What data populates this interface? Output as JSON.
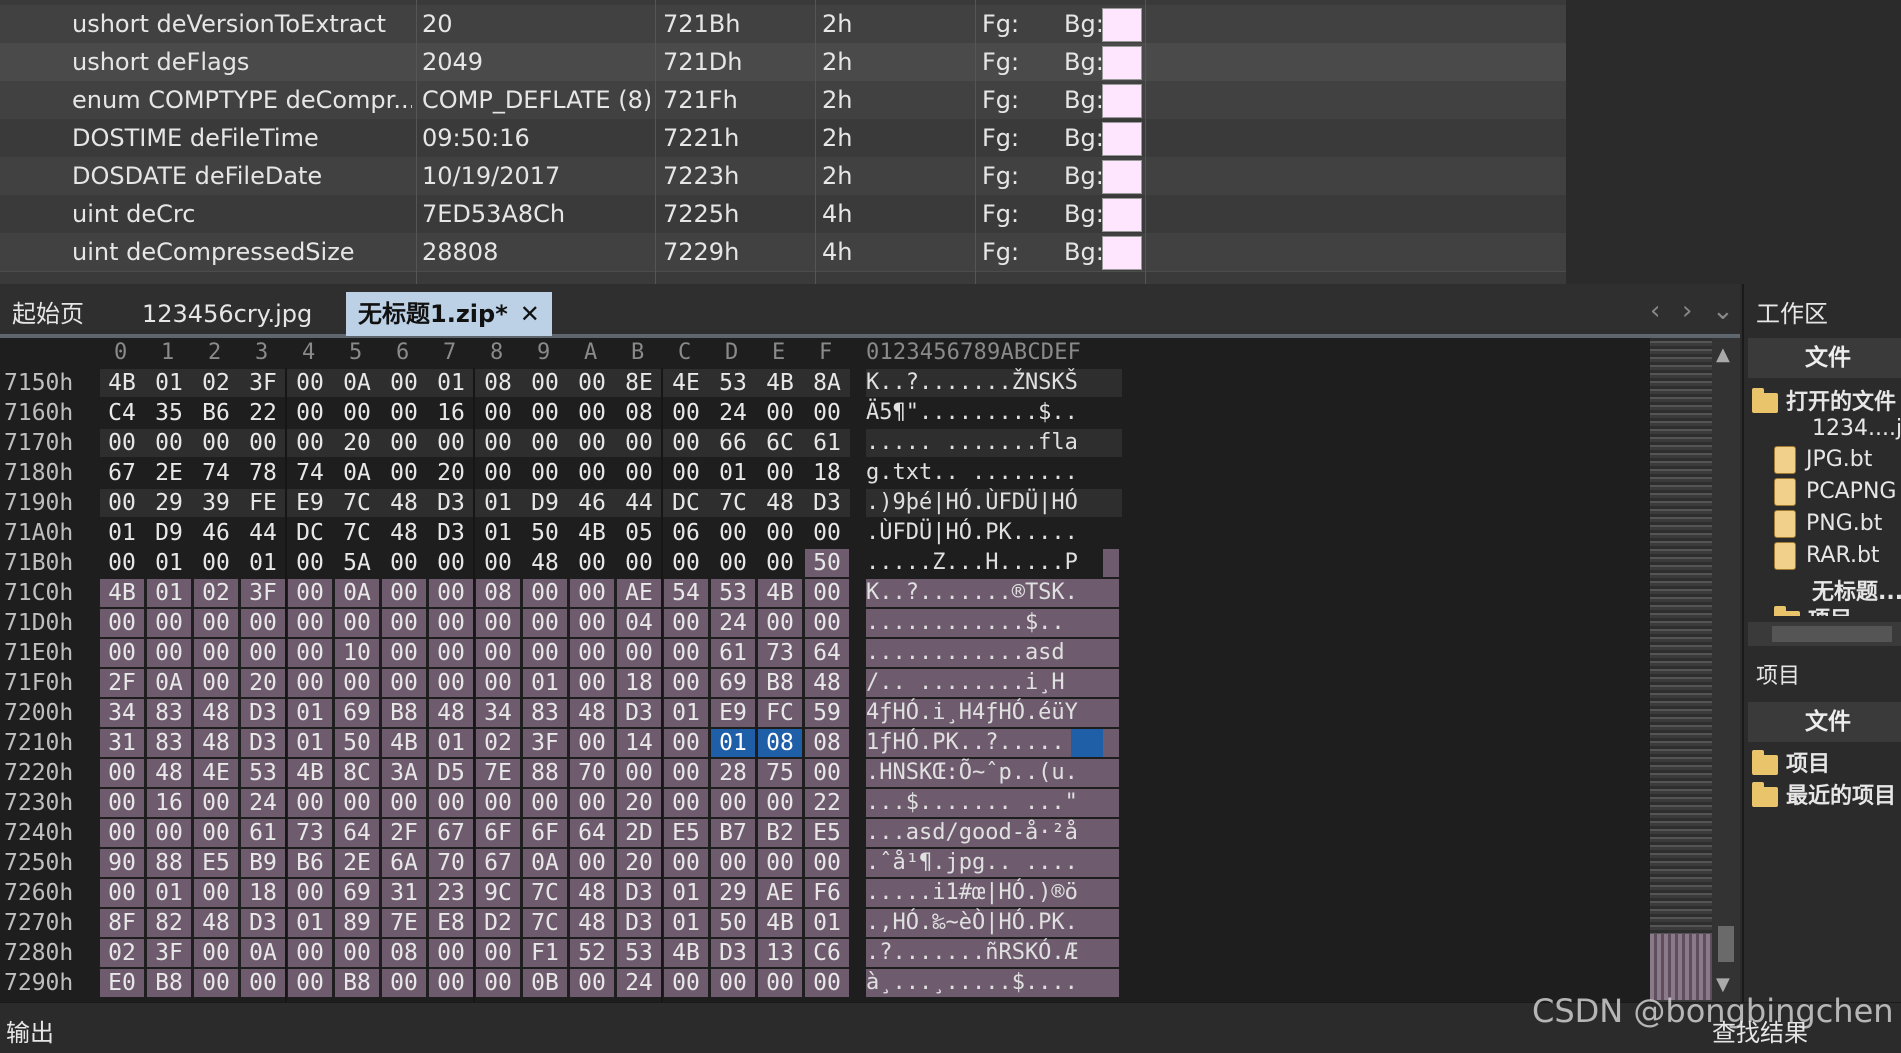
{
  "template": {
    "fg_label": "Fg:",
    "bg_label": "Bg:",
    "bg_color": "#ffe6ff",
    "rows": [
      {
        "name": "ushort deVersionToExtract",
        "value": "20",
        "start": "721Bh",
        "size": "2h"
      },
      {
        "name": "ushort deFlags",
        "value": "2049",
        "start": "721Dh",
        "size": "2h"
      },
      {
        "name": "enum COMPTYPE deCompr...",
        "value": "COMP_DEFLATE (8)",
        "start": "721Fh",
        "size": "2h"
      },
      {
        "name": "DOSTIME deFileTime",
        "value": "09:50:16",
        "start": "7221h",
        "size": "2h"
      },
      {
        "name": "DOSDATE deFileDate",
        "value": "10/19/2017",
        "start": "7223h",
        "size": "2h"
      },
      {
        "name": "uint deCrc",
        "value": "7ED53A8Ch",
        "start": "7225h",
        "size": "4h"
      },
      {
        "name": "uint deCompressedSize",
        "value": "28808",
        "start": "7229h",
        "size": "4h"
      }
    ]
  },
  "tabs": [
    {
      "label": "起始页"
    },
    {
      "label": "123456cry.jpg"
    },
    {
      "label": "无标题1.zip*"
    }
  ],
  "tab_close_symbol": "✕",
  "hex": {
    "columns": [
      "0",
      "1",
      "2",
      "3",
      "4",
      "5",
      "6",
      "7",
      "8",
      "9",
      "A",
      "B",
      "C",
      "D",
      "E",
      "F"
    ],
    "ascii_header": "0123456789ABCDEF",
    "rows": [
      {
        "addr": "7150h",
        "bytes": [
          "4B",
          "01",
          "02",
          "3F",
          "00",
          "0A",
          "00",
          "01",
          "08",
          "00",
          "00",
          "8E",
          "4E",
          "53",
          "4B",
          "8A"
        ],
        "ascii": "K..?.......ŽNSKŠ"
      },
      {
        "addr": "7160h",
        "bytes": [
          "C4",
          "35",
          "B6",
          "22",
          "00",
          "00",
          "00",
          "16",
          "00",
          "00",
          "00",
          "08",
          "00",
          "24",
          "00",
          "00"
        ],
        "ascii": "Ä5¶\".........$.."
      },
      {
        "addr": "7170h",
        "bytes": [
          "00",
          "00",
          "00",
          "00",
          "00",
          "20",
          "00",
          "00",
          "00",
          "00",
          "00",
          "00",
          "00",
          "66",
          "6C",
          "61"
        ],
        "ascii": "..... .......fla"
      },
      {
        "addr": "7180h",
        "bytes": [
          "67",
          "2E",
          "74",
          "78",
          "74",
          "0A",
          "00",
          "20",
          "00",
          "00",
          "00",
          "00",
          "00",
          "01",
          "00",
          "18"
        ],
        "ascii": "g.txt.. ........"
      },
      {
        "addr": "7190h",
        "bytes": [
          "00",
          "29",
          "39",
          "FE",
          "E9",
          "7C",
          "48",
          "D3",
          "01",
          "D9",
          "46",
          "44",
          "DC",
          "7C",
          "48",
          "D3"
        ],
        "ascii": ".)9þé|HÓ.ÙFDÜ|HÓ"
      },
      {
        "addr": "71A0h",
        "bytes": [
          "01",
          "D9",
          "46",
          "44",
          "DC",
          "7C",
          "48",
          "D3",
          "01",
          "50",
          "4B",
          "05",
          "06",
          "00",
          "00",
          "00"
        ],
        "ascii": ".ÙFDÜ|HÓ.PK....."
      },
      {
        "addr": "71B0h",
        "bytes": [
          "00",
          "01",
          "00",
          "01",
          "00",
          "5A",
          "00",
          "00",
          "00",
          "48",
          "00",
          "00",
          "00",
          "00",
          "00",
          "50"
        ],
        "ascii": ".....Z...H.....P"
      },
      {
        "addr": "71C0h",
        "bytes": [
          "4B",
          "01",
          "02",
          "3F",
          "00",
          "0A",
          "00",
          "00",
          "08",
          "00",
          "00",
          "AE",
          "54",
          "53",
          "4B",
          "00"
        ],
        "ascii": "K..?.......®TSK."
      },
      {
        "addr": "71D0h",
        "bytes": [
          "00",
          "00",
          "00",
          "00",
          "00",
          "00",
          "00",
          "00",
          "00",
          "00",
          "00",
          "04",
          "00",
          "24",
          "00",
          "00"
        ],
        "ascii": "............$.."
      },
      {
        "addr": "71E0h",
        "bytes": [
          "00",
          "00",
          "00",
          "00",
          "00",
          "10",
          "00",
          "00",
          "00",
          "00",
          "00",
          "00",
          "00",
          "61",
          "73",
          "64"
        ],
        "ascii": "............asd"
      },
      {
        "addr": "71F0h",
        "bytes": [
          "2F",
          "0A",
          "00",
          "20",
          "00",
          "00",
          "00",
          "00",
          "00",
          "01",
          "00",
          "18",
          "00",
          "69",
          "B8",
          "48"
        ],
        "ascii": "/.. ........i¸H"
      },
      {
        "addr": "7200h",
        "bytes": [
          "34",
          "83",
          "48",
          "D3",
          "01",
          "69",
          "B8",
          "48",
          "34",
          "83",
          "48",
          "D3",
          "01",
          "E9",
          "FC",
          "59"
        ],
        "ascii": "4ƒHÓ.i¸H4ƒHÓ.éüY"
      },
      {
        "addr": "7210h",
        "bytes": [
          "31",
          "83",
          "48",
          "D3",
          "01",
          "50",
          "4B",
          "01",
          "02",
          "3F",
          "00",
          "14",
          "00",
          "01",
          "08",
          "08"
        ],
        "ascii": "1ƒHÓ.PK..?....."
      },
      {
        "addr": "7220h",
        "bytes": [
          "00",
          "48",
          "4E",
          "53",
          "4B",
          "8C",
          "3A",
          "D5",
          "7E",
          "88",
          "70",
          "00",
          "00",
          "28",
          "75",
          "00"
        ],
        "ascii": ".HNSKŒ:Õ~ˆp..(u."
      },
      {
        "addr": "7230h",
        "bytes": [
          "00",
          "16",
          "00",
          "24",
          "00",
          "00",
          "00",
          "00",
          "00",
          "00",
          "00",
          "20",
          "00",
          "00",
          "00",
          "22"
        ],
        "ascii": "...$....... ...\""
      },
      {
        "addr": "7240h",
        "bytes": [
          "00",
          "00",
          "00",
          "61",
          "73",
          "64",
          "2F",
          "67",
          "6F",
          "6F",
          "64",
          "2D",
          "E5",
          "B7",
          "B2",
          "E5"
        ],
        "ascii": "...asd/good-å·²å"
      },
      {
        "addr": "7250h",
        "bytes": [
          "90",
          "88",
          "E5",
          "B9",
          "B6",
          "2E",
          "6A",
          "70",
          "67",
          "0A",
          "00",
          "20",
          "00",
          "00",
          "00",
          "00"
        ],
        "ascii": ".ˆå¹¶.jpg.. ...."
      },
      {
        "addr": "7260h",
        "bytes": [
          "00",
          "01",
          "00",
          "18",
          "00",
          "69",
          "31",
          "23",
          "9C",
          "7C",
          "48",
          "D3",
          "01",
          "29",
          "AE",
          "F6"
        ],
        "ascii": ".....i1#œ|HÓ.)®ö"
      },
      {
        "addr": "7270h",
        "bytes": [
          "8F",
          "82",
          "48",
          "D3",
          "01",
          "89",
          "7E",
          "E8",
          "D2",
          "7C",
          "48",
          "D3",
          "01",
          "50",
          "4B",
          "01"
        ],
        "ascii": ".‚HÓ.‰~èÒ|HÓ.PK."
      },
      {
        "addr": "7280h",
        "bytes": [
          "02",
          "3F",
          "00",
          "0A",
          "00",
          "00",
          "08",
          "00",
          "00",
          "F1",
          "52",
          "53",
          "4B",
          "D3",
          "13",
          "C6"
        ],
        "ascii": ".?.......ñRSKÓ.Æ"
      },
      {
        "addr": "7290h",
        "bytes": [
          "E0",
          "B8",
          "00",
          "00",
          "00",
          "B8",
          "00",
          "00",
          "00",
          "0B",
          "00",
          "24",
          "00",
          "00",
          "00",
          "00"
        ],
        "ascii": "à¸...¸.....$...."
      }
    ]
  },
  "workspace": {
    "title": "工作区",
    "files_header": "文件",
    "open_files_label": "打开的文件",
    "open_file_entry": "1234....j",
    "scripts": [
      "JPG.bt",
      "PCAPNG",
      "PNG.bt",
      "RAR.bt"
    ],
    "current_file": "无标题...",
    "projects_label_partial": "项目",
    "projects_section": "项目",
    "files_header2": "文件",
    "project_item": "项目",
    "recent_projects": "最近的项目"
  },
  "output": {
    "label": "输出",
    "right_label": "查找结果"
  },
  "watermark": "CSDN @bongbingchen"
}
